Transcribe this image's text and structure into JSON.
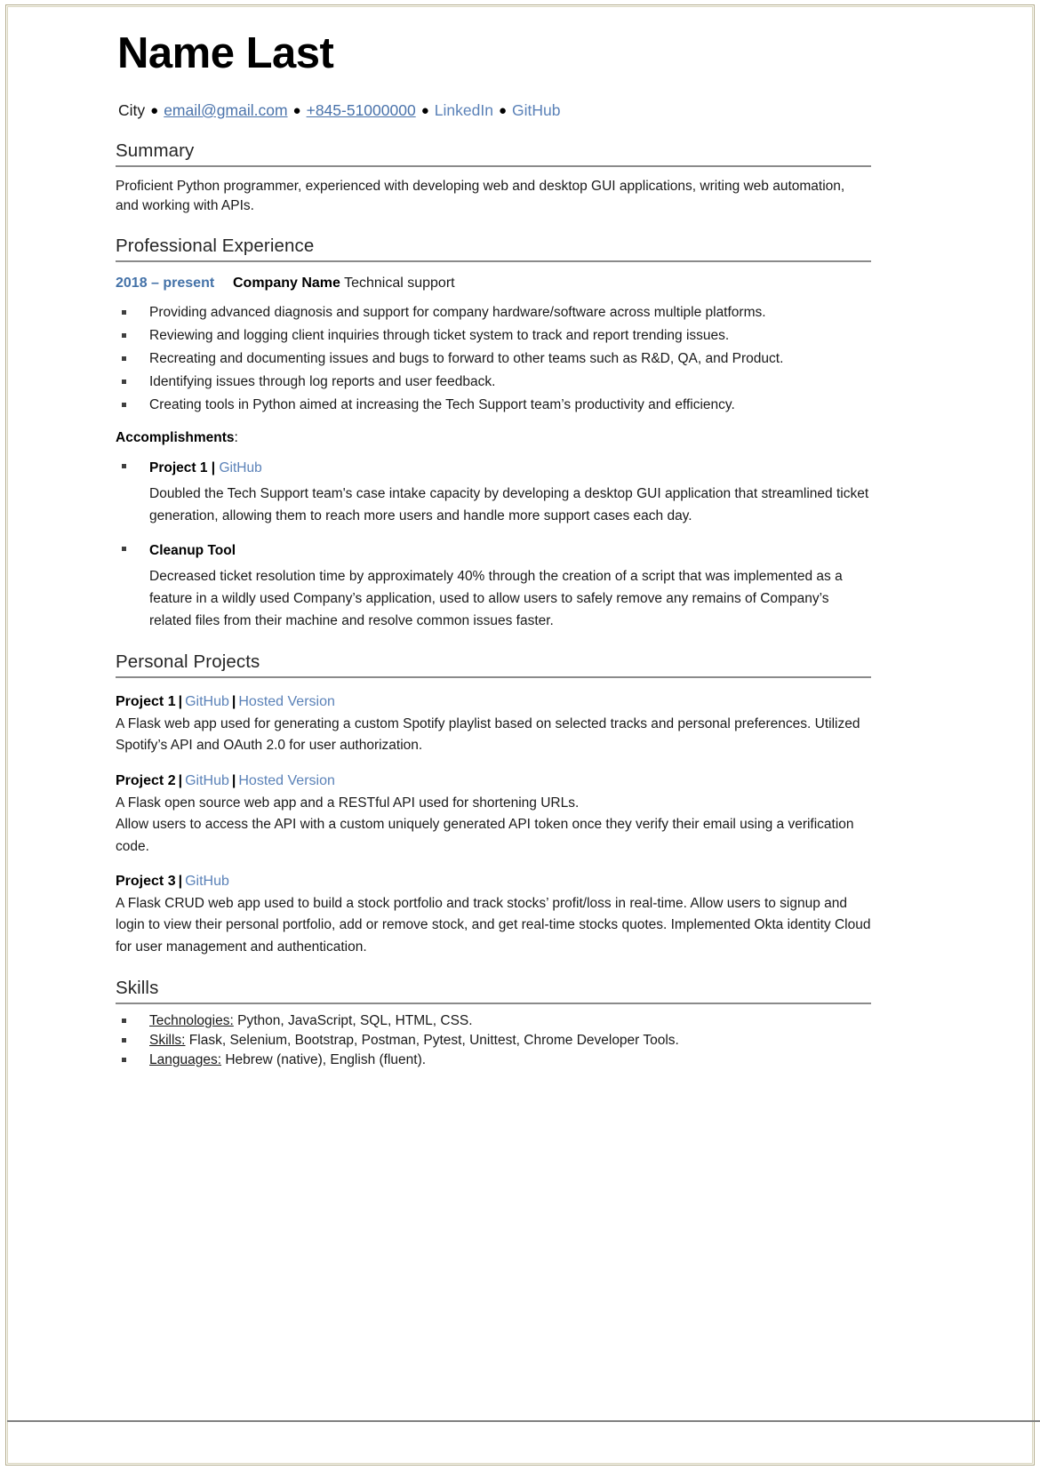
{
  "document": {
    "type": "resume",
    "name": "Name Last"
  },
  "colors": {
    "link_blue": "#4a73ab",
    "date_blue": "#4472a8",
    "rule_gray": "#8a8a8a",
    "text": "#1a1a1a",
    "page_border": "#b3ac8e"
  },
  "header": {
    "name": "Name Last",
    "contact": {
      "city": "City",
      "email": "email@gmail.com",
      "phone": "+845-51000000",
      "linkedin": "LinkedIn",
      "github": "GitHub",
      "separator": "●"
    }
  },
  "summary": {
    "title": "Summary",
    "text": "Proficient Python programmer, experienced with developing web and desktop GUI applications, writing web automation, and working with APIs."
  },
  "experience": {
    "title": "Professional Experience",
    "jobs": [
      {
        "dates": "2018 – present",
        "company": "Company Name",
        "role": "Technical support",
        "bullets": [
          "Providing advanced diagnosis and support for company hardware/software across multiple platforms.",
          "Reviewing and logging client inquiries through ticket system to track and report trending issues.",
          "Recreating and documenting issues and bugs to forward to other teams such as R&D, QA, and Product.",
          "Identifying issues through log reports and user feedback.",
          "Creating tools in Python aimed at increasing the Tech Support team’s productivity and efficiency."
        ],
        "accomplishments_label": "Accomplishments",
        "accomplishments_colon": ":",
        "accomplishments": [
          {
            "name": "Project 1",
            "pipe": "|",
            "link_label": "GitHub",
            "description": "Doubled the Tech Support team's case intake capacity by developing a desktop GUI application that streamlined ticket generation, allowing them to reach more users and handle more support cases each day."
          },
          {
            "name": "Cleanup Tool",
            "pipe": "",
            "link_label": "",
            "description": "Decreased ticket resolution time by approximately 40% through the creation of a script that was implemented as a feature in a wildly used Company’s application, used to allow users to safely remove any remains of Company’s related files from their machine and resolve common issues faster."
          }
        ]
      }
    ]
  },
  "personal_projects": {
    "title": "Personal Projects",
    "projects": [
      {
        "name": "Project 1",
        "pipe": "|",
        "links": [
          "GitHub",
          "Hosted Version"
        ],
        "description": "A Flask web app used for generating a custom Spotify playlist based on selected tracks and personal preferences. Utilized Spotify’s API and OAuth 2.0 for user authorization."
      },
      {
        "name": "Project 2",
        "pipe": "|",
        "links": [
          "GitHub",
          "Hosted Version"
        ],
        "description": "A Flask open source web app and a RESTful API used for shortening URLs.\nAllow users to access the API with a custom uniquely generated API token once they verify their email using a verification code."
      },
      {
        "name": "Project 3",
        "pipe": "|",
        "links": [
          "GitHub"
        ],
        "description": "A Flask CRUD web app used to build a stock portfolio and track stocks’ profit/loss in real-time. Allow users to signup and login to view their personal portfolio, add or remove stock, and get real-time stocks quotes. Implemented Okta identity Cloud for user management and authentication."
      }
    ]
  },
  "skills": {
    "title": "Skills",
    "items": [
      {
        "label": "Technologies:",
        "value": "Python, JavaScript, SQL, HTML, CSS."
      },
      {
        "label": "Skills:",
        "value": "Flask, Selenium, Bootstrap, Postman, Pytest, Unittest, Chrome Developer Tools."
      },
      {
        "label": "Languages:",
        "value": "Hebrew (native), English (fluent)."
      }
    ]
  }
}
